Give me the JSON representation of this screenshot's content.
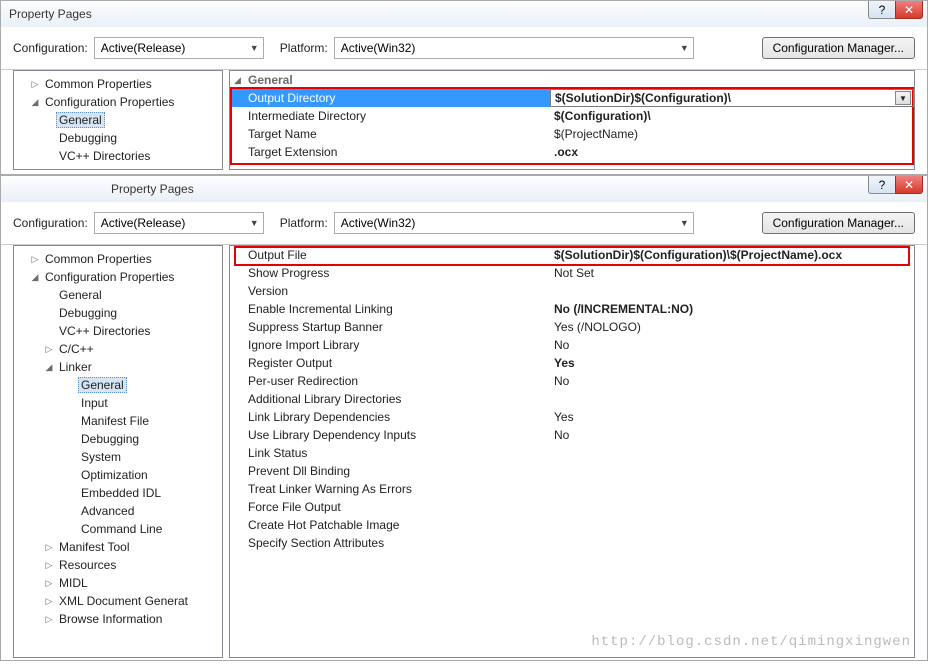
{
  "windowA": {
    "title": "Property Pages",
    "help": "?",
    "close": "✕",
    "toolbar": {
      "configLabel": "Configuration:",
      "configValue": "Active(Release)",
      "platformLabel": "Platform:",
      "platformValue": "Active(Win32)",
      "cfgMgr": "Configuration Manager..."
    },
    "tree": {
      "common": "Common Properties",
      "config": "Configuration Properties",
      "general": "General",
      "debugging": "Debugging",
      "vcdirs": "VC++ Directories"
    },
    "grid": {
      "head": "General",
      "rows": [
        {
          "n": "Output Directory",
          "v": "$(SolutionDir)$(Configuration)\\",
          "sel": true,
          "bold": true
        },
        {
          "n": "Intermediate Directory",
          "v": "$(Configuration)\\",
          "bold": true
        },
        {
          "n": "Target Name",
          "v": "$(ProjectName)"
        },
        {
          "n": "Target Extension",
          "v": ".ocx",
          "bold": true
        }
      ]
    }
  },
  "windowB": {
    "title": "Property Pages",
    "help": "?",
    "close": "✕",
    "toolbar": {
      "configLabel": "Configuration:",
      "configValue": "Active(Release)",
      "platformLabel": "Platform:",
      "platformValue": "Active(Win32)",
      "cfgMgr": "Configuration Manager..."
    },
    "tree": {
      "common": "Common Properties",
      "config": "Configuration Properties",
      "general": "General",
      "debugging": "Debugging",
      "vcdirs": "VC++ Directories",
      "cc": "C/C++",
      "linker": "Linker",
      "linkerGeneral": "General",
      "linkerInput": "Input",
      "linkerManifest": "Manifest File",
      "linkerDebugging": "Debugging",
      "linkerSystem": "System",
      "linkerOpt": "Optimization",
      "linkerIDL": "Embedded IDL",
      "linkerAdv": "Advanced",
      "linkerCmd": "Command Line",
      "manifestTool": "Manifest Tool",
      "resources": "Resources",
      "midl": "MIDL",
      "xml": "XML Document Generat",
      "browse": "Browse Information"
    },
    "grid": {
      "rows": [
        {
          "n": "Output File",
          "v": "$(SolutionDir)$(Configuration)\\$(ProjectName).ocx",
          "bold": true,
          "hl": true
        },
        {
          "n": "Show Progress",
          "v": "Not Set"
        },
        {
          "n": "Version",
          "v": ""
        },
        {
          "n": "Enable Incremental Linking",
          "v": "No (/INCREMENTAL:NO)",
          "bold": true
        },
        {
          "n": "Suppress Startup Banner",
          "v": "Yes (/NOLOGO)"
        },
        {
          "n": "Ignore Import Library",
          "v": "No"
        },
        {
          "n": "Register Output",
          "v": "Yes",
          "bold": true
        },
        {
          "n": "Per-user Redirection",
          "v": "No"
        },
        {
          "n": "Additional Library Directories",
          "v": ""
        },
        {
          "n": "Link Library Dependencies",
          "v": "Yes"
        },
        {
          "n": "Use Library Dependency Inputs",
          "v": "No"
        },
        {
          "n": "Link Status",
          "v": ""
        },
        {
          "n": "Prevent Dll Binding",
          "v": ""
        },
        {
          "n": "Treat Linker Warning As Errors",
          "v": ""
        },
        {
          "n": "Force File Output",
          "v": ""
        },
        {
          "n": "Create Hot Patchable Image",
          "v": ""
        },
        {
          "n": "Specify Section Attributes",
          "v": ""
        }
      ]
    }
  },
  "watermark": "http://blog.csdn.net/qimingxingwen"
}
